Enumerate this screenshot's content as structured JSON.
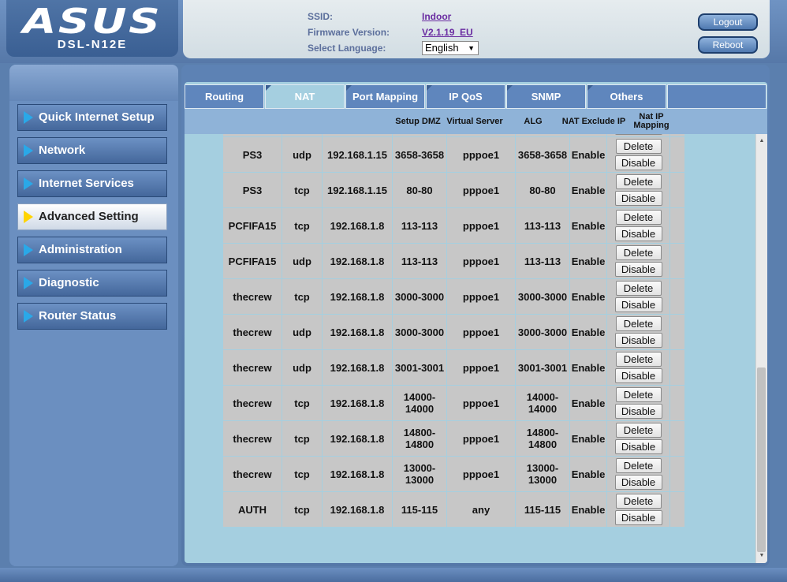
{
  "brand": {
    "logo": "ASUS",
    "model": "DSL-N12E"
  },
  "info": {
    "ssid_label": "SSID:",
    "ssid_value": "Indoor",
    "firmware_label": "Firmware Version:",
    "firmware_value": "V2.1.19_EU",
    "language_label": "Select Language:",
    "language_value": "English"
  },
  "header_buttons": {
    "logout": "Logout",
    "reboot": "Reboot"
  },
  "menu": [
    {
      "label": "Quick Internet Setup",
      "active": false
    },
    {
      "label": "Network",
      "active": false
    },
    {
      "label": "Internet Services",
      "active": false
    },
    {
      "label": "Advanced Setting",
      "active": true
    },
    {
      "label": "Administration",
      "active": false
    },
    {
      "label": "Diagnostic",
      "active": false
    },
    {
      "label": "Router Status",
      "active": false
    }
  ],
  "tabs": [
    {
      "label": "Routing",
      "active": false
    },
    {
      "label": "NAT",
      "active": true
    },
    {
      "label": "Port Mapping",
      "active": false
    },
    {
      "label": "IP QoS",
      "active": false
    },
    {
      "label": "SNMP",
      "active": false
    },
    {
      "label": "Others",
      "active": false
    }
  ],
  "subnav": {
    "setup_dmz": "Setup DMZ",
    "virtual_server": "Virtual Server",
    "alg": "ALG",
    "nat_exclude_ip": "NAT Exclude IP",
    "nat_ip_mapping": "Nat IP Mapping"
  },
  "row_buttons": {
    "delete": "Delete",
    "disable": "Disable"
  },
  "rules": [
    {
      "name": "",
      "proto": "",
      "ip": "",
      "ext_port": "",
      "iface": "",
      "int_port": "",
      "status": ""
    },
    {
      "name": "PS3",
      "proto": "udp",
      "ip": "192.168.1.15",
      "ext_port": "3658-3658",
      "iface": "pppoe1",
      "int_port": "3658-3658",
      "status": "Enable"
    },
    {
      "name": "PS3",
      "proto": "tcp",
      "ip": "192.168.1.15",
      "ext_port": "80-80",
      "iface": "pppoe1",
      "int_port": "80-80",
      "status": "Enable"
    },
    {
      "name": "PCFIFA15",
      "proto": "tcp",
      "ip": "192.168.1.8",
      "ext_port": "113-113",
      "iface": "pppoe1",
      "int_port": "113-113",
      "status": "Enable"
    },
    {
      "name": "PCFIFA15",
      "proto": "udp",
      "ip": "192.168.1.8",
      "ext_port": "113-113",
      "iface": "pppoe1",
      "int_port": "113-113",
      "status": "Enable"
    },
    {
      "name": "thecrew",
      "proto": "tcp",
      "ip": "192.168.1.8",
      "ext_port": "3000-3000",
      "iface": "pppoe1",
      "int_port": "3000-3000",
      "status": "Enable"
    },
    {
      "name": "thecrew",
      "proto": "udp",
      "ip": "192.168.1.8",
      "ext_port": "3000-3000",
      "iface": "pppoe1",
      "int_port": "3000-3000",
      "status": "Enable"
    },
    {
      "name": "thecrew",
      "proto": "udp",
      "ip": "192.168.1.8",
      "ext_port": "3001-3001",
      "iface": "pppoe1",
      "int_port": "3001-3001",
      "status": "Enable"
    },
    {
      "name": "thecrew",
      "proto": "tcp",
      "ip": "192.168.1.8",
      "ext_port": "14000-14000",
      "iface": "pppoe1",
      "int_port": "14000-14000",
      "status": "Enable"
    },
    {
      "name": "thecrew",
      "proto": "tcp",
      "ip": "192.168.1.8",
      "ext_port": "14800-14800",
      "iface": "pppoe1",
      "int_port": "14800-14800",
      "status": "Enable"
    },
    {
      "name": "thecrew",
      "proto": "tcp",
      "ip": "192.168.1.8",
      "ext_port": "13000-13000",
      "iface": "pppoe1",
      "int_port": "13000-13000",
      "status": "Enable"
    },
    {
      "name": "AUTH",
      "proto": "tcp",
      "ip": "192.168.1.8",
      "ext_port": "115-115",
      "iface": "any",
      "int_port": "115-115",
      "status": "Enable"
    }
  ],
  "colors": {
    "accent": "#5f86bd",
    "panel": "#a5cfe0",
    "active_marker": "#ffd400",
    "menu_marker": "#2aa8e8"
  }
}
